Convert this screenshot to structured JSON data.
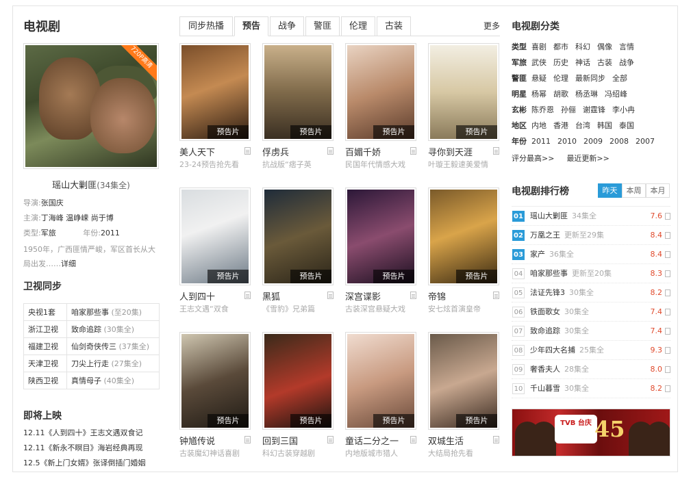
{
  "left": {
    "section_title": "电视剧",
    "featured": {
      "badge": "720P高清",
      "title": "瑶山大剿匪",
      "episodes": "(34集全)",
      "director_label": "导演:",
      "director": "张国庆",
      "cast_label": "主演:",
      "cast": "丁海峰 温峥嵘 尚于博",
      "type_label": "类型:",
      "type": "军旅",
      "year_label": "年份:",
      "year": "2011",
      "desc": "1950年，广西匪情严峻，军区首长从大局出发……",
      "detail_link": "详细"
    },
    "satellite_title": "卫视同步",
    "satellite": [
      {
        "channel": "央视1套",
        "show": "咱家那些事",
        "ep": "(至20集)"
      },
      {
        "channel": "浙江卫视",
        "show": "致命追踪",
        "ep": "(30集全)"
      },
      {
        "channel": "福建卫视",
        "show": "仙剑奇侠传三",
        "ep": "(37集全)"
      },
      {
        "channel": "天津卫视",
        "show": "刀尖上行走",
        "ep": "(27集全)"
      },
      {
        "channel": "陕西卫视",
        "show": "真情母子",
        "ep": "(40集全)"
      }
    ],
    "upcoming_title": "即将上映",
    "upcoming": [
      "12.11《人到四十》王志文遇双食记",
      "12.11《新永不瞑目》海岩经典再现",
      "12.5《新上门女婿》张译倒插门婚姻"
    ]
  },
  "middle": {
    "tabs": [
      "同步热播",
      "预告",
      "战争",
      "警匪",
      "伦理",
      "古装"
    ],
    "active_tab": "预告",
    "more": "更多",
    "tag": "预告片",
    "cards": [
      {
        "title": "美人天下",
        "sub": "23-24预告抢先看"
      },
      {
        "title": "俘虏兵",
        "sub": "抗战版“痞子英"
      },
      {
        "title": "百媚千娇",
        "sub": "民国年代情感大戏"
      },
      {
        "title": "寻你到天涯",
        "sub": "叶璇王毅速美爱情"
      },
      {
        "title": "人到四十",
        "sub": "王志文遇“双食"
      },
      {
        "title": "黑狐",
        "sub": "《雪豹》兄弟篇"
      },
      {
        "title": "深宫谍影",
        "sub": "古装深宫悬疑大戏"
      },
      {
        "title": "帝锦",
        "sub": "安七炫首演皇帝"
      },
      {
        "title": "钟馗传说",
        "sub": "古装魔幻神话喜剧"
      },
      {
        "title": "回到三国",
        "sub": "科幻古装穿越剧"
      },
      {
        "title": "童话二分之一",
        "sub": "内地版城市猎人"
      },
      {
        "title": "双城生活",
        "sub": "大结局抢先看"
      }
    ]
  },
  "right": {
    "category_title": "电视剧分类",
    "categories": [
      {
        "label": "类型",
        "items": [
          "喜剧",
          "都市",
          "科幻",
          "偶像",
          "言情"
        ]
      },
      {
        "label": "军旅",
        "items": [
          "武侠",
          "历史",
          "神话",
          "古装",
          "战争"
        ]
      },
      {
        "label": "警匪",
        "items": [
          "悬疑",
          "伦理",
          "最新同步",
          "全部"
        ]
      },
      {
        "label": "明星",
        "items": [
          "杨幂",
          "胡歌",
          "杨丞琳",
          "冯绍峰"
        ]
      },
      {
        "label": "玄彬",
        "items": [
          "陈乔恩",
          "孙俪",
          "谢霆锋",
          "李小冉"
        ]
      },
      {
        "label": "地区",
        "items": [
          "内地",
          "香港",
          "台湾",
          "韩国",
          "泰国"
        ]
      },
      {
        "label": "年份",
        "items": [
          "2011",
          "2010",
          "2009",
          "2008",
          "2007"
        ]
      }
    ],
    "sort_links": [
      "评分最高>>",
      "最近更新>>"
    ],
    "rank_title": "电视剧排行榜",
    "rank_tabs": [
      "昨天",
      "本周",
      "本月"
    ],
    "rank_active": "昨天",
    "rank": [
      {
        "num": "01",
        "name": "瑶山大剿匪",
        "ep": "34集全",
        "score": "7.6"
      },
      {
        "num": "02",
        "name": "万凰之王",
        "ep": "更新至29集",
        "score": "8.4"
      },
      {
        "num": "03",
        "name": "家产",
        "ep": "36集全",
        "score": "8.4"
      },
      {
        "num": "04",
        "name": "咱家那些事",
        "ep": "更新至20集",
        "score": "8.3"
      },
      {
        "num": "05",
        "name": "法证先锋3",
        "ep": "30集全",
        "score": "8.2"
      },
      {
        "num": "06",
        "name": "铁面歌女",
        "ep": "30集全",
        "score": "7.4"
      },
      {
        "num": "07",
        "name": "致命追踪",
        "ep": "30集全",
        "score": "7.4"
      },
      {
        "num": "08",
        "name": "少年四大名捕",
        "ep": "25集全",
        "score": "9.3"
      },
      {
        "num": "09",
        "name": "奢香夫人",
        "ep": "28集全",
        "score": "8.0"
      },
      {
        "num": "10",
        "name": "千山暮雪",
        "ep": "30集全",
        "score": "8.2"
      }
    ],
    "ad": {
      "logo": "TVB 台庆",
      "num": "45"
    }
  },
  "colors": {
    "accent": "#2a9bd8",
    "score": "#e04a2c",
    "badge": "#ff7a1a"
  }
}
